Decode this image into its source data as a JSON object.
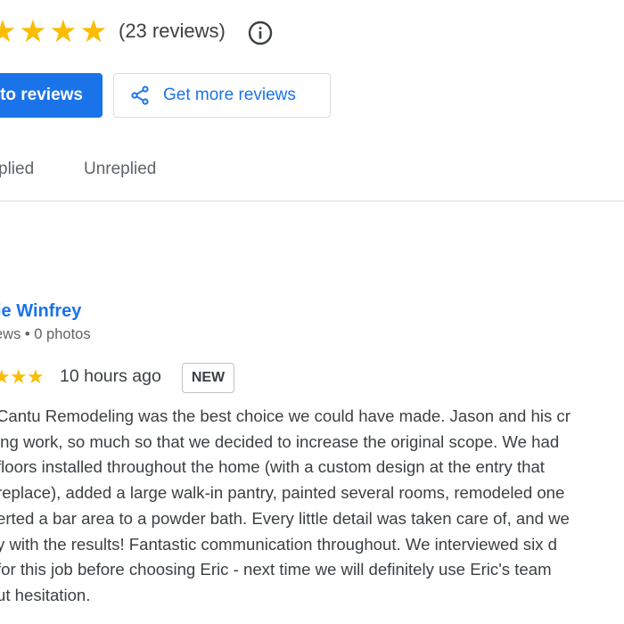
{
  "rating": {
    "stars": 5,
    "count_label": "(23 reviews)"
  },
  "actions": {
    "primary_label": "to reviews",
    "secondary_label": "Get more reviews"
  },
  "tabs": [
    {
      "label": "plied"
    },
    {
      "label": "Unreplied"
    }
  ],
  "review": {
    "reviewer_name": "ie Winfrey",
    "reviewer_meta": "ews • 0 photos",
    "stars": 5,
    "time": "10 hours ago",
    "badge": "NEW",
    "lines": [
      "Cantu Remodeling was the best choice we could have made. Jason and his cr",
      "ing work, so much so that we decided to increase the original scope. We had",
      " floors installed throughout the home (with a custom design at the entry that",
      "replace), added a large walk-in pantry, painted several rooms, remodeled one",
      "erted a bar area to a powder bath. Every little detail was taken care of, and we",
      "y with the results! Fantastic communication throughout. We interviewed six d",
      " for this job before choosing Eric - next time we will definitely use Eric's team",
      "ut hesitation."
    ]
  },
  "colors": {
    "accent": "#1a73e8",
    "star": "#fbbc04",
    "text": "#3c4043",
    "muted": "#5f6368",
    "border": "#dadce0"
  },
  "icons": {
    "info": "info-circle-icon",
    "share": "share-icon",
    "star": "star-icon"
  }
}
